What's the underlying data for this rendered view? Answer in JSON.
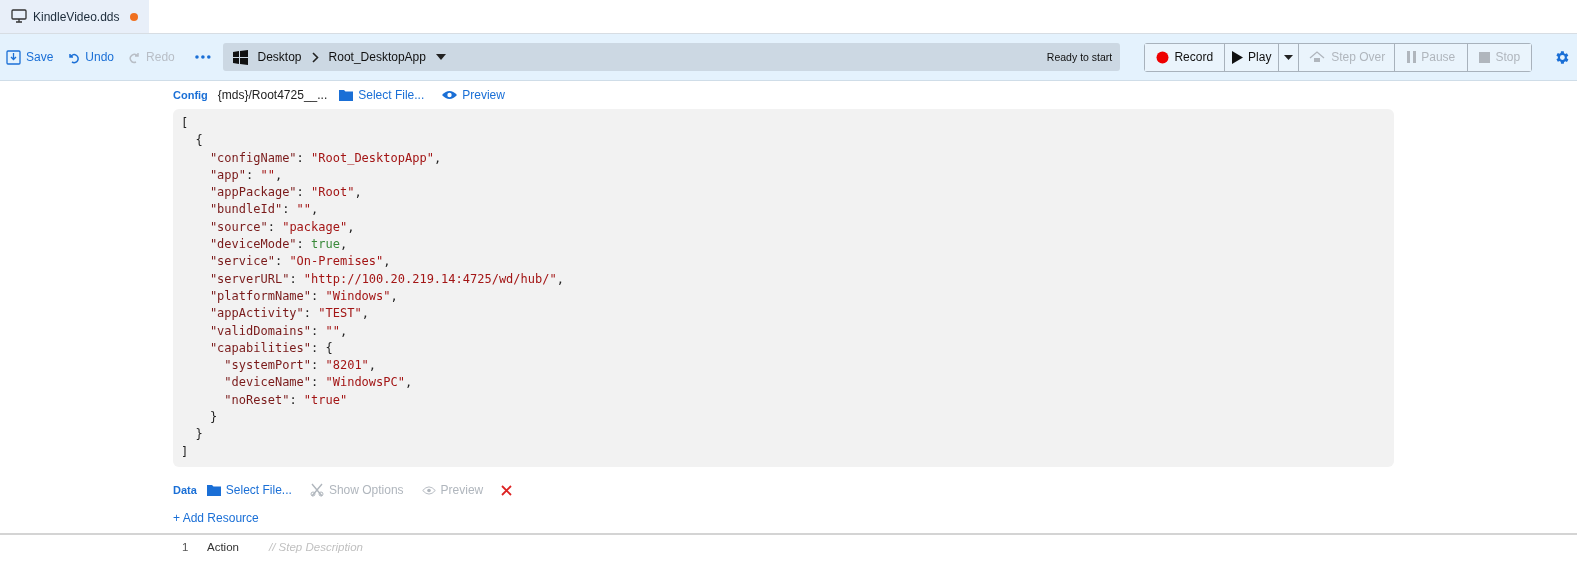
{
  "tab": {
    "title": "KindleVideo.dds",
    "unsaved": true
  },
  "toolbar": {
    "actions": [
      {
        "label": "Save",
        "kind": "save",
        "disabled": false
      },
      {
        "label": "Undo",
        "kind": "undo",
        "disabled": false
      },
      {
        "label": "Redo",
        "kind": "redo",
        "disabled": true
      }
    ],
    "breadcrumb": [
      "Desktop",
      "Root_DesktopApp"
    ],
    "status": "Ready to start",
    "controls": [
      {
        "label": "Record",
        "kind": "record",
        "disabled": false
      },
      {
        "label": "Play",
        "kind": "play",
        "disabled": false
      },
      {
        "label": "Step Over",
        "kind": "step",
        "disabled": true
      },
      {
        "label": "Pause",
        "kind": "pause",
        "disabled": true
      },
      {
        "label": "Stop",
        "kind": "stop",
        "disabled": true
      }
    ]
  },
  "config": {
    "label": "Config",
    "path": "{mds}/Root4725__...",
    "select_file": "Select File...",
    "preview": "Preview",
    "lines": [
      [
        {
          "kind": "punct",
          "text": "["
        }
      ],
      [
        {
          "kind": "punct",
          "text": "  {"
        }
      ],
      [
        {
          "kind": "key",
          "text": "    \"configName\""
        },
        {
          "kind": "punct",
          "text": ": "
        },
        {
          "kind": "string",
          "text": "\"Root_DesktopApp\""
        },
        {
          "kind": "punct",
          "text": ","
        }
      ],
      [
        {
          "kind": "key",
          "text": "    \"app\""
        },
        {
          "kind": "punct",
          "text": ": "
        },
        {
          "kind": "string",
          "text": "\"\""
        },
        {
          "kind": "punct",
          "text": ","
        }
      ],
      [
        {
          "kind": "key",
          "text": "    \"appPackage\""
        },
        {
          "kind": "punct",
          "text": ": "
        },
        {
          "kind": "string",
          "text": "\"Root\""
        },
        {
          "kind": "punct",
          "text": ","
        }
      ],
      [
        {
          "kind": "key",
          "text": "    \"bundleId\""
        },
        {
          "kind": "punct",
          "text": ": "
        },
        {
          "kind": "string",
          "text": "\"\""
        },
        {
          "kind": "punct",
          "text": ","
        }
      ],
      [
        {
          "kind": "key",
          "text": "    \"source\""
        },
        {
          "kind": "punct",
          "text": ": "
        },
        {
          "kind": "string",
          "text": "\"package\""
        },
        {
          "kind": "punct",
          "text": ","
        }
      ],
      [
        {
          "kind": "key",
          "text": "    \"deviceMode\""
        },
        {
          "kind": "punct",
          "text": ": "
        },
        {
          "kind": "literal",
          "text": "true"
        },
        {
          "kind": "punct",
          "text": ","
        }
      ],
      [
        {
          "kind": "key",
          "text": "    \"service\""
        },
        {
          "kind": "punct",
          "text": ": "
        },
        {
          "kind": "string",
          "text": "\"On-Premises\""
        },
        {
          "kind": "punct",
          "text": ","
        }
      ],
      [
        {
          "kind": "key",
          "text": "    \"serverURL\""
        },
        {
          "kind": "punct",
          "text": ": "
        },
        {
          "kind": "string",
          "text": "\"http://100.20.219.14:4725/wd/hub/\""
        },
        {
          "kind": "punct",
          "text": ","
        }
      ],
      [
        {
          "kind": "key",
          "text": "    \"platformName\""
        },
        {
          "kind": "punct",
          "text": ": "
        },
        {
          "kind": "string",
          "text": "\"Windows\""
        },
        {
          "kind": "punct",
          "text": ","
        }
      ],
      [
        {
          "kind": "key",
          "text": "    \"appActivity\""
        },
        {
          "kind": "punct",
          "text": ": "
        },
        {
          "kind": "string",
          "text": "\"TEST\""
        },
        {
          "kind": "punct",
          "text": ","
        }
      ],
      [
        {
          "kind": "key",
          "text": "    \"validDomains\""
        },
        {
          "kind": "punct",
          "text": ": "
        },
        {
          "kind": "string",
          "text": "\"\""
        },
        {
          "kind": "punct",
          "text": ","
        }
      ],
      [
        {
          "kind": "key",
          "text": "    \"capabilities\""
        },
        {
          "kind": "punct",
          "text": ": {"
        }
      ],
      [
        {
          "kind": "key",
          "text": "      \"systemPort\""
        },
        {
          "kind": "punct",
          "text": ": "
        },
        {
          "kind": "string",
          "text": "\"8201\""
        },
        {
          "kind": "punct",
          "text": ","
        }
      ],
      [
        {
          "kind": "key",
          "text": "      \"deviceName\""
        },
        {
          "kind": "punct",
          "text": ": "
        },
        {
          "kind": "string",
          "text": "\"WindowsPC\""
        },
        {
          "kind": "punct",
          "text": ","
        }
      ],
      [
        {
          "kind": "key",
          "text": "      \"noReset\""
        },
        {
          "kind": "punct",
          "text": ": "
        },
        {
          "kind": "string",
          "text": "\"true\""
        }
      ],
      [
        {
          "kind": "punct",
          "text": "    }"
        }
      ],
      [
        {
          "kind": "punct",
          "text": "  }"
        }
      ],
      [
        {
          "kind": "punct",
          "text": "]"
        }
      ]
    ]
  },
  "data": {
    "label": "Data",
    "select_file": "Select File...",
    "show_options": {
      "label": "Show Options",
      "disabled": true
    },
    "preview": {
      "label": "Preview",
      "disabled": true
    }
  },
  "add_resource": "+ Add Resource",
  "steps": [
    {
      "number": "1",
      "action": "Action",
      "placeholder": "// Step Description"
    }
  ]
}
